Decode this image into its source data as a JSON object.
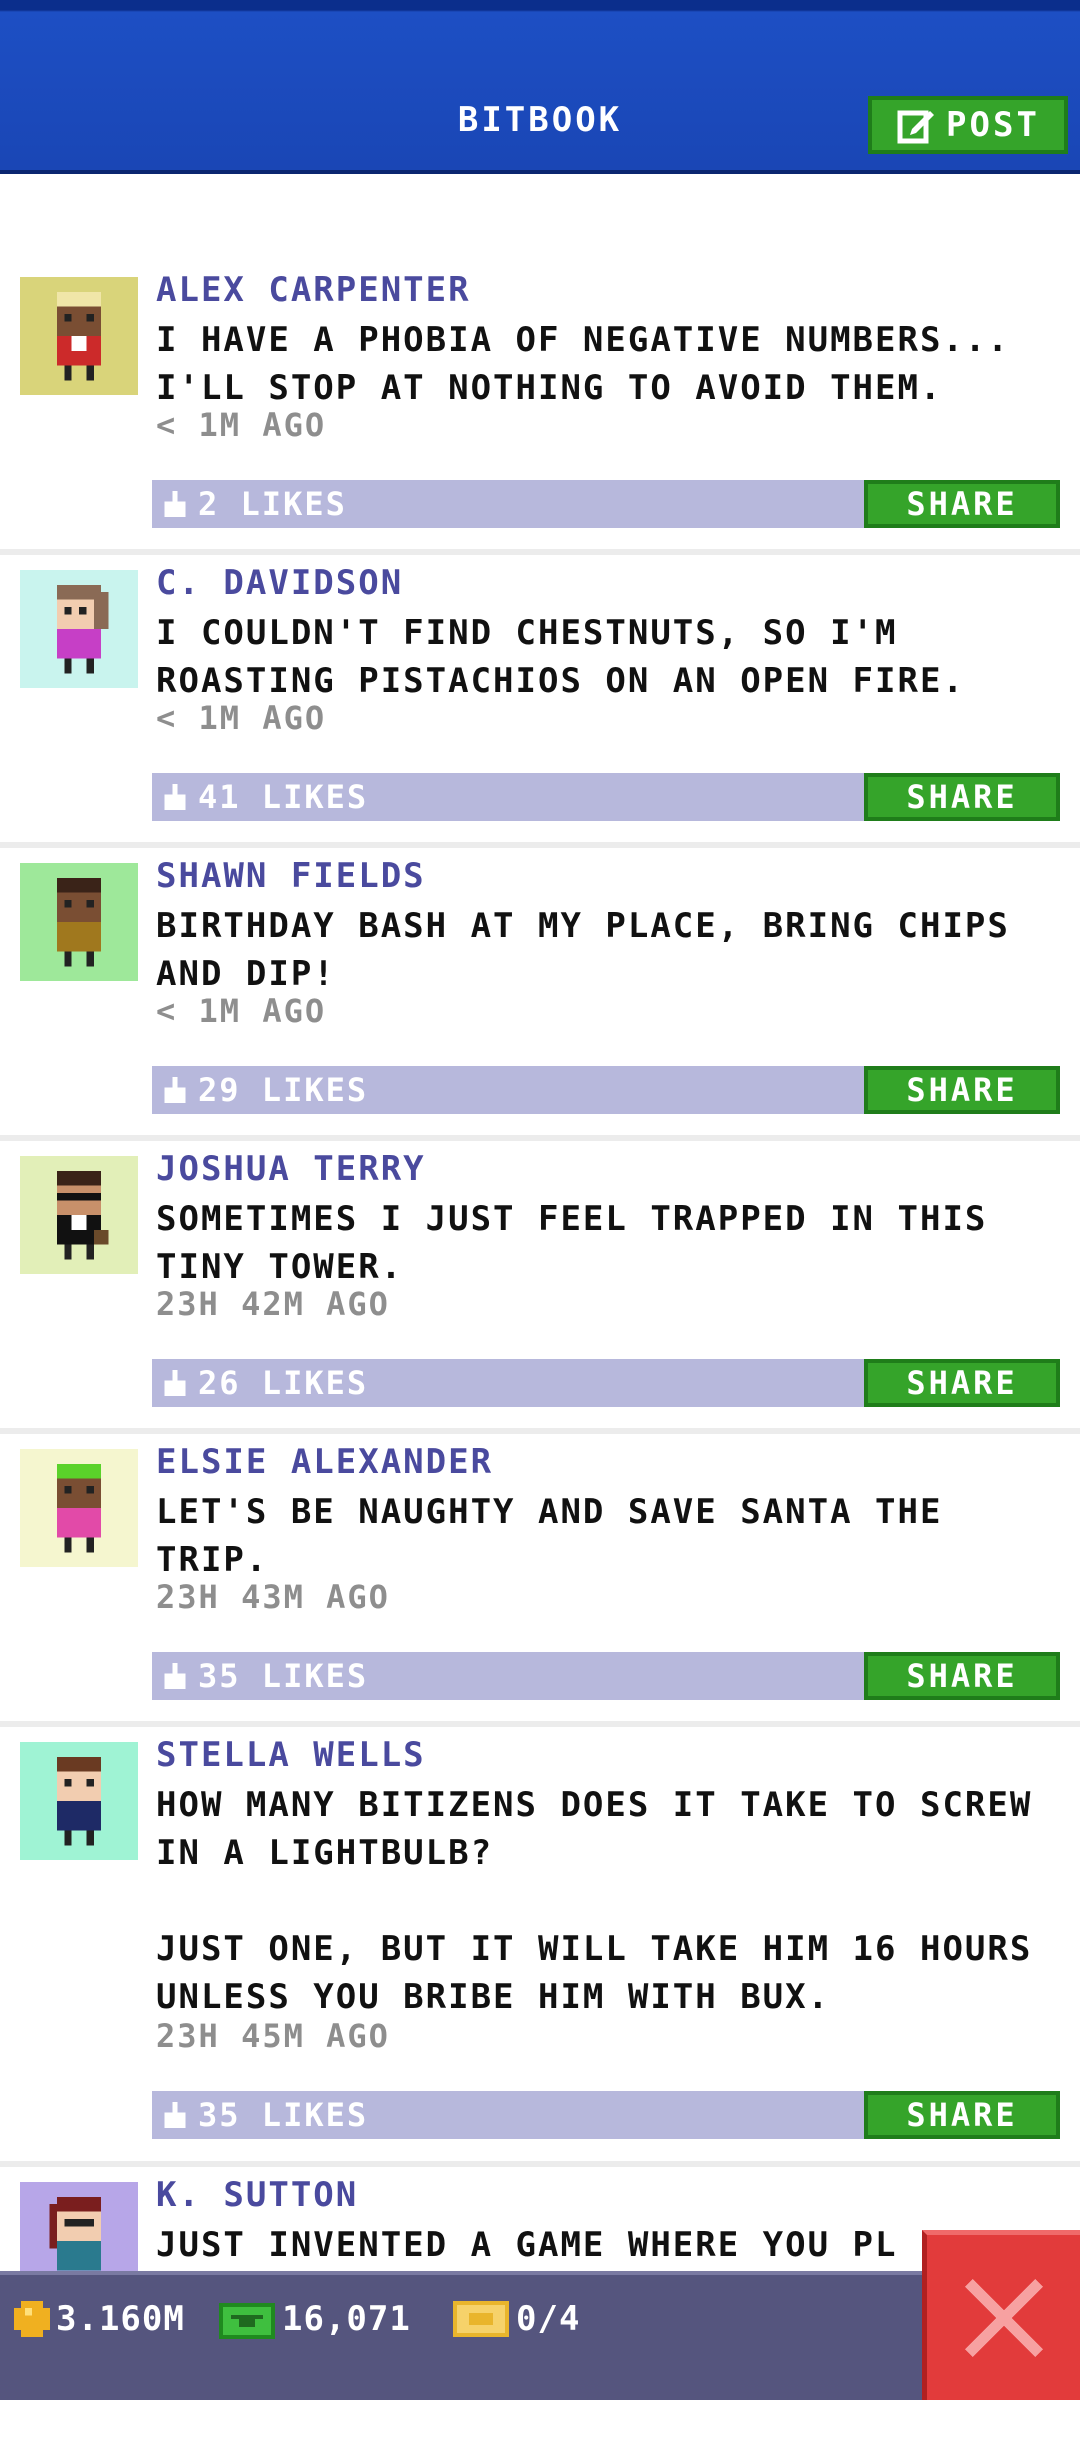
{
  "header": {
    "title": "BITBOOK",
    "post_label": "POST"
  },
  "posts": [
    {
      "name": "ALEX CARPENTER",
      "message": "I HAVE A PHOBIA OF NEGATIVE NUMBERS...\nI'LL STOP AT NOTHING TO AVOID THEM.",
      "time": "< 1M AGO",
      "likes": "2 LIKES",
      "share": "SHARE"
    },
    {
      "name": "C. DAVIDSON",
      "message": "I COULDN'T FIND CHESTNUTS, SO I'M\nROASTING PISTACHIOS ON AN OPEN FIRE.",
      "time": "< 1M AGO",
      "likes": "41 LIKES",
      "share": "SHARE"
    },
    {
      "name": "SHAWN FIELDS",
      "message": "BIRTHDAY BASH AT MY PLACE, BRING CHIPS\nAND DIP!",
      "time": "< 1M AGO",
      "likes": "29 LIKES",
      "share": "SHARE"
    },
    {
      "name": "JOSHUA TERRY",
      "message": "SOMETIMES I JUST FEEL TRAPPED IN THIS\nTINY TOWER.",
      "time": "23H 42M AGO",
      "likes": "26 LIKES",
      "share": "SHARE"
    },
    {
      "name": "ELSIE ALEXANDER",
      "message": "LET'S BE NAUGHTY AND SAVE SANTA THE\nTRIP.",
      "time": "23H 43M AGO",
      "likes": "35 LIKES",
      "share": "SHARE"
    },
    {
      "name": "STELLA WELLS",
      "message": "HOW MANY BITIZENS DOES IT TAKE TO SCREW\nIN A LIGHTBULB?\n\nJUST ONE, BUT IT WILL TAKE HIM 16 HOURS\nUNLESS YOU BRIBE HIM WITH BUX.",
      "time": "23H 45M AGO",
      "likes": "35 LIKES",
      "share": "SHARE"
    },
    {
      "name": "K. SUTTON",
      "message": "JUST INVENTED A GAME WHERE YOU PL"
    }
  ],
  "bottom_bar": {
    "coins": "3.160M",
    "bux": "16,071",
    "tickets": "0/4"
  },
  "colors": {
    "header_blue": "#1a46b5",
    "accent_green": "#35a42a",
    "name_purple": "#4a4a9e",
    "close_red": "#e23b3b"
  }
}
